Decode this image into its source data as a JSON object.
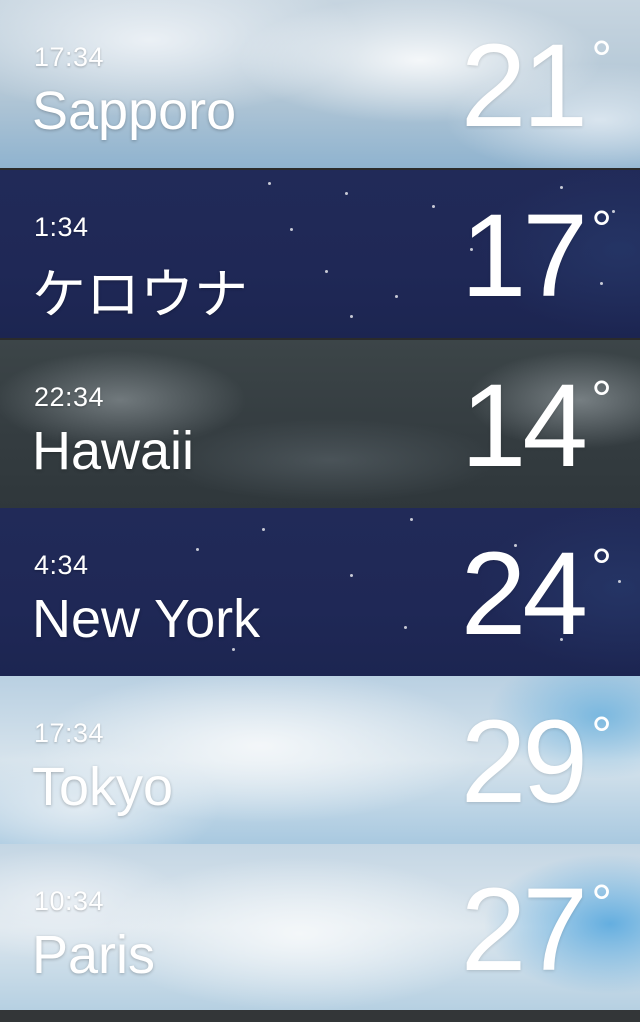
{
  "cities": [
    {
      "time": "17:34",
      "name": "Sapporo",
      "temp": "21",
      "deg": "°"
    },
    {
      "time": "1:34",
      "name": "ケロウナ",
      "temp": "17",
      "deg": "°"
    },
    {
      "time": "22:34",
      "name": "Hawaii",
      "temp": "14",
      "deg": "°"
    },
    {
      "time": "4:34",
      "name": "New York",
      "temp": "24",
      "deg": "°"
    },
    {
      "time": "17:34",
      "name": "Tokyo",
      "temp": "29",
      "deg": "°"
    },
    {
      "time": "10:34",
      "name": "Paris",
      "temp": "27",
      "deg": "°"
    }
  ],
  "colors": {
    "night_sky": "#212a58",
    "overcast": "#3a4346",
    "text": "#ffffff",
    "bottom_bar": "#333638"
  }
}
